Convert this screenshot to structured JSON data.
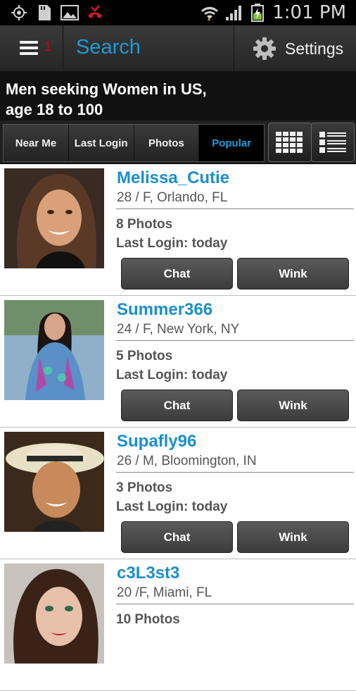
{
  "status_bar": {
    "time": "1:01 PM",
    "icons": [
      "gps-icon",
      "sd-card-icon",
      "gallery-icon",
      "missed-call-icon",
      "wifi-icon",
      "signal-icon",
      "battery-charging-icon"
    ]
  },
  "action_bar": {
    "menu_count": "1",
    "title": "Search",
    "settings_label": "Settings"
  },
  "criteria": {
    "line1": "Men seeking Women in US,",
    "line2": "age 18 to 100"
  },
  "filters": {
    "tabs": [
      {
        "label": "Near Me",
        "active": false
      },
      {
        "label": "Last Login",
        "active": false
      },
      {
        "label": "Photos",
        "active": false
      },
      {
        "label": "Popular",
        "active": true
      }
    ],
    "views": [
      "grid-view-icon",
      "list-view-icon"
    ]
  },
  "accent_color": "#1f9ad6",
  "results": [
    {
      "name": "Melissa_Cutie",
      "meta": "28 / F, Orlando, FL",
      "photos": "8 Photos",
      "login": "Last Login: today",
      "chat_label": "Chat",
      "wink_label": "Wink"
    },
    {
      "name": "Summer366",
      "meta": "24 / F, New York, NY",
      "photos": "5 Photos",
      "login": "Last Login: today",
      "chat_label": "Chat",
      "wink_label": "Wink"
    },
    {
      "name": "Supafly96",
      "meta": "26 / M, Bloomington, IN",
      "photos": "3 Photos",
      "login": "Last Login: today",
      "chat_label": "Chat",
      "wink_label": "Wink"
    },
    {
      "name": "c3L3st3",
      "meta": "20 /F, Miami, FL",
      "photos": "10 Photos",
      "login": "",
      "chat_label": "",
      "wink_label": ""
    }
  ]
}
